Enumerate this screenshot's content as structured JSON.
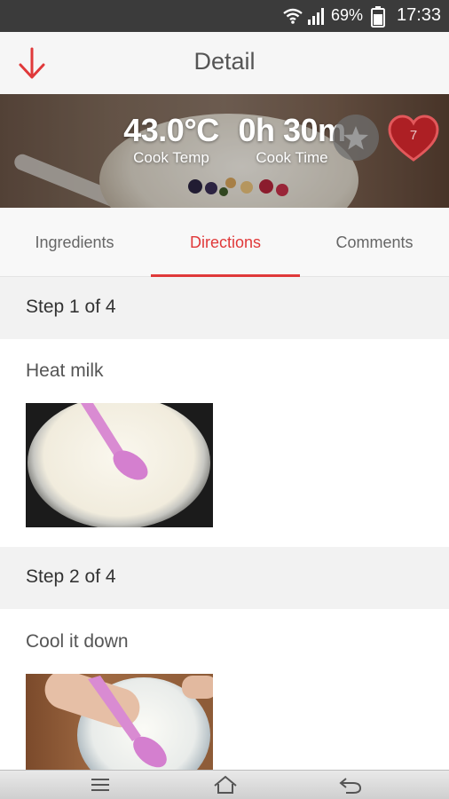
{
  "status_bar": {
    "battery_percent": "69%",
    "time": "17:33"
  },
  "header": {
    "title": "Detail"
  },
  "hero": {
    "cook_temp": {
      "value": "43.0°C",
      "label": "Cook Temp"
    },
    "cook_time": {
      "value": "0h 30m",
      "label": "Cook Time"
    },
    "like_count": "7"
  },
  "tabs": [
    {
      "label": "Ingredients",
      "active": false
    },
    {
      "label": "Directions",
      "active": true
    },
    {
      "label": "Comments",
      "active": false
    }
  ],
  "steps": [
    {
      "header": "Step 1 of 4",
      "text": "Heat milk"
    },
    {
      "header": "Step 2 of 4",
      "text": "Cool it down"
    }
  ],
  "colors": {
    "accent": "#e0393a",
    "status_bar": "#3b3b3b",
    "app_bar": "#f6f6f6",
    "step_header_bg": "#f2f2f2"
  },
  "icons": {
    "back": "arrow-down-icon",
    "favorite": "star-icon",
    "like": "heart-icon",
    "nav_menu": "menu-icon",
    "nav_home": "home-icon",
    "nav_back": "back-icon"
  }
}
